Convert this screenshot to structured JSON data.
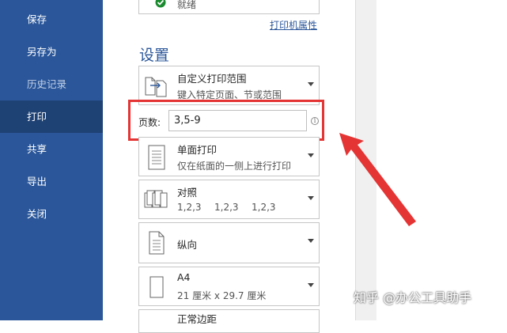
{
  "sidebar": {
    "items": [
      {
        "label": "保存"
      },
      {
        "label": "另存为"
      },
      {
        "label": "历史记录"
      },
      {
        "label": "打印"
      },
      {
        "label": "共享"
      },
      {
        "label": "导出"
      },
      {
        "label": "关闭"
      }
    ],
    "active": "打印"
  },
  "printer": {
    "status": "就绪",
    "properties_link": "打印机属性"
  },
  "settings": {
    "title": "设置",
    "range": {
      "title": "自定义打印范围",
      "subtitle": "键入特定页面、节或范围",
      "icon": "page-range-icon"
    },
    "pages": {
      "label": "页数:",
      "value": "3,5-9",
      "icon": "info-icon"
    },
    "sides": {
      "title": "单面打印",
      "subtitle": "仅在纸面的一侧上进行打印",
      "icon": "single-sided-icon"
    },
    "collate": {
      "title": "对照",
      "nums": [
        "1,2,3",
        "1,2,3",
        "1,2,3"
      ],
      "icon": "collate-icon"
    },
    "orientation": {
      "title": "纵向",
      "icon": "portrait-icon"
    },
    "paper": {
      "title": "A4",
      "subtitle": "21 厘米 x 29.7 厘米",
      "icon": "paper-size-icon"
    },
    "margins": {
      "title": "正常边距"
    }
  },
  "annotation": {
    "color": "#e53434"
  },
  "watermark": {
    "text": "知乎 @办公工具助手"
  },
  "colors": {
    "sidebar": "#2b579a",
    "sidebar_active": "#1f4274",
    "accent": "#2b579a"
  }
}
